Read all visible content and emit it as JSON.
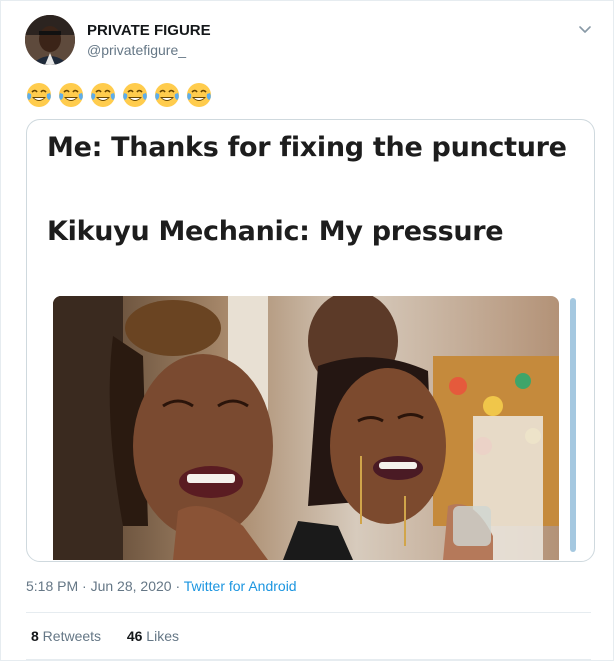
{
  "tweet": {
    "author": {
      "name": "PRIVATE FIGURE",
      "handle": "@privatefigure_",
      "avatar_icon": "avatar"
    },
    "text_emojis": [
      "face-with-tears-of-joy",
      "face-with-tears-of-joy",
      "face-with-tears-of-joy",
      "face-with-tears-of-joy",
      "face-with-tears-of-joy",
      "face-with-tears-of-joy"
    ],
    "menu_icon": "chevron-down-icon",
    "media": {
      "line1": "Me: Thanks for fixing the puncture",
      "line2": "Kikuyu Mechanic: My pressure"
    },
    "meta": {
      "time": "5:18 PM",
      "sep1": " · ",
      "date": "Jun 28, 2020",
      "sep2": " · ",
      "source": "Twitter for Android"
    },
    "stats": {
      "retweets_count": "8",
      "retweets_label": " Retweets",
      "likes_count": "46",
      "likes_label": " Likes"
    }
  },
  "colors": {
    "name": "#14171a",
    "secondary": "#657786",
    "link": "#1b95e0",
    "border": "#e6ecf0"
  }
}
